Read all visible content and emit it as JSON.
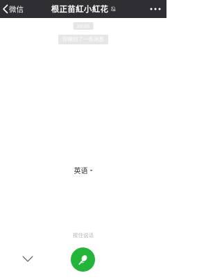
{
  "navbar": {
    "back_label": "微信",
    "title": "根正苗紅小紅花",
    "more_icon": "more-dots-icon",
    "mute_icon": "mute-bell-icon",
    "background": "#2e2e33"
  },
  "chat": {
    "timestamp": "20:05",
    "system_message": "你撤回了一条消息"
  },
  "voice_input": {
    "language": "英语",
    "hint": "按住说话",
    "mic_color": "#23b43a",
    "collapse_icon": "chevron-down-icon",
    "mic_icon": "microphone-icon"
  }
}
